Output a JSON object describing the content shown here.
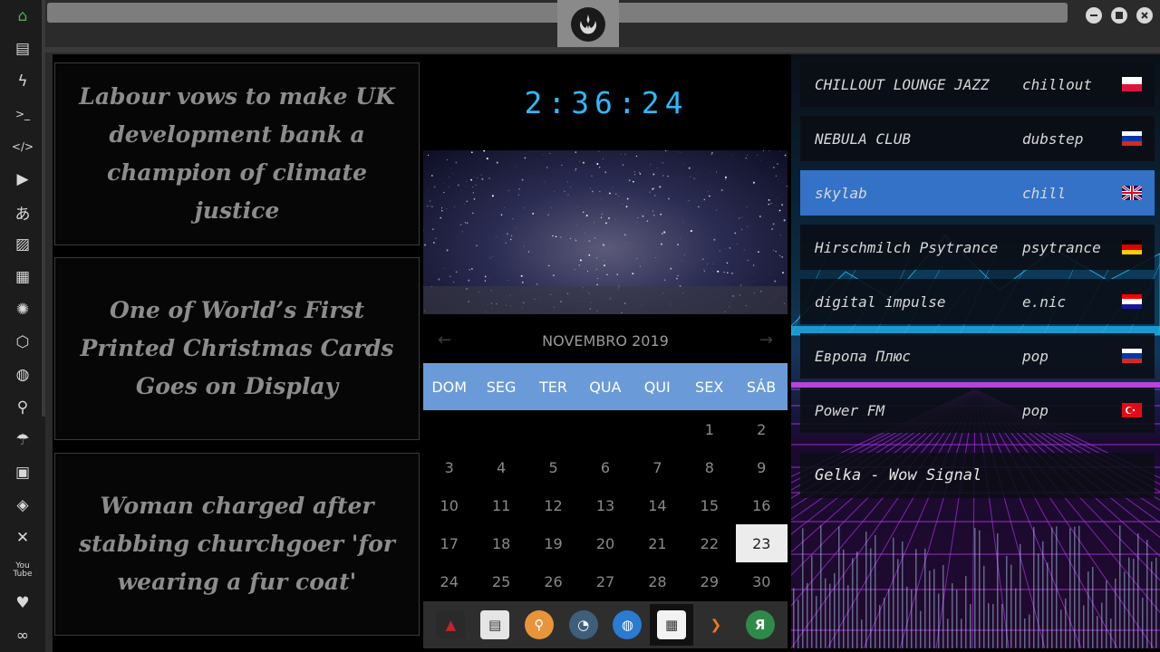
{
  "window": {
    "buttons": [
      "minimize",
      "maximize",
      "close"
    ],
    "logo_icon": "rebel-alliance-icon"
  },
  "sidebar": {
    "items": [
      {
        "icon": "home-icon",
        "active": true
      },
      {
        "icon": "document-icon"
      },
      {
        "icon": "lightning-icon"
      },
      {
        "icon": "terminal-icon"
      },
      {
        "icon": "code-icon"
      },
      {
        "icon": "play-icon"
      },
      {
        "icon": "translate-icon"
      },
      {
        "icon": "image-icon"
      },
      {
        "icon": "news-icon"
      },
      {
        "icon": "rebel-alliance-icon"
      },
      {
        "icon": "empire-icon"
      },
      {
        "icon": "globe-icon"
      },
      {
        "icon": "search-icon"
      },
      {
        "icon": "umbrella-icon"
      },
      {
        "icon": "contacts-icon"
      },
      {
        "icon": "tag-icon"
      },
      {
        "icon": "expand-icon"
      },
      {
        "icon": "youtube-icon",
        "label": "You Tube"
      },
      {
        "icon": "heart-icon"
      },
      {
        "icon": "infinity-icon"
      }
    ]
  },
  "news": [
    "Labour vows to make UK development bank a champion of climate justice",
    "One of World’s First Printed Christmas Cards Goes on Display",
    "Woman charged after stabbing churchgoer 'for wearing a fur coat'"
  ],
  "clock": {
    "time": "2:36:24"
  },
  "calendar": {
    "month_label": "NOVEMBRO 2019",
    "prev_icon": "arrow-left-icon",
    "next_icon": "arrow-right-icon",
    "weekdays": [
      "DOM",
      "SEG",
      "TER",
      "QUA",
      "QUI",
      "SEX",
      "SÁB"
    ],
    "leading_blanks": 5,
    "days": [
      "1",
      "2",
      "3",
      "4",
      "5",
      "6",
      "7",
      "8",
      "9",
      "10",
      "11",
      "12",
      "13",
      "14",
      "15",
      "16",
      "17",
      "18",
      "19",
      "20",
      "21",
      "22",
      "23",
      "24",
      "25",
      "26",
      "27",
      "28",
      "29",
      "30"
    ],
    "selected_day": "23"
  },
  "dock": [
    {
      "icon": "red-triangle-app-icon",
      "color": "#c0262b"
    },
    {
      "icon": "news-reader-icon",
      "color": "#e5e5e5"
    },
    {
      "icon": "search-app-icon",
      "color": "#e8943a"
    },
    {
      "icon": "clock-app-icon",
      "color": "#3d5f7a"
    },
    {
      "icon": "globe-app-icon",
      "color": "#2a7bd1"
    },
    {
      "icon": "calendar-app-icon",
      "color": "#e34040",
      "active": true
    },
    {
      "icon": "arrow-app-icon",
      "color": "#f07a1a"
    },
    {
      "icon": "yandex-app-icon",
      "color": "#2f8a4a",
      "label": "Я"
    }
  ],
  "radio": {
    "stations": [
      {
        "name": "CHILLOUT LOUNGE JAZZ",
        "genre": "chillout",
        "flag": "poland"
      },
      {
        "name": "NEBULA CLUB",
        "genre": "dubstep",
        "flag": "russia"
      },
      {
        "name": "skylab",
        "genre": "chill",
        "flag": "uk",
        "selected": true
      },
      {
        "name": "Hirschmilch Psytrance",
        "genre": "psytrance",
        "flag": "germany"
      },
      {
        "name": "digital impulse",
        "genre": "e.nic",
        "flag": "croatia"
      },
      {
        "name": "Европа Плюс",
        "genre": "pop",
        "flag": "russia"
      },
      {
        "name": "Power FM",
        "genre": "pop",
        "flag": "turkey"
      }
    ],
    "now_playing": "Gelka - Wow Signal"
  },
  "colors": {
    "accent_blue": "#2cb9ff",
    "calendar_header": "#6a9bd8",
    "selected_station": "#3472c7",
    "home_green": "#4caf50"
  }
}
